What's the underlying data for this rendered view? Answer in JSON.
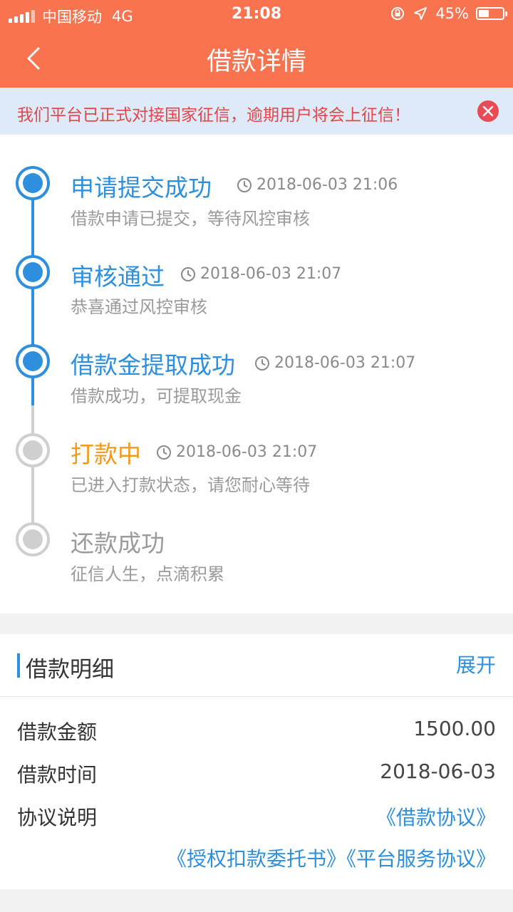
{
  "status_bar": {
    "carrier": "中国移动",
    "network": "4G",
    "time": "21:08",
    "battery": "45%",
    "battery_level": 0.45
  },
  "nav": {
    "title": "借款详情"
  },
  "notice": {
    "text": "我们平台已正式对接国家征信，逾期用户将会上征信！"
  },
  "timeline": {
    "steps": [
      {
        "title": "申请提交成功",
        "time": "2018-06-03 21:06",
        "desc": "借款申请已提交，等待风控审核",
        "state": "done"
      },
      {
        "title": "审核通过",
        "time": "2018-06-03 21:07",
        "desc": "恭喜通过风控审核",
        "state": "done"
      },
      {
        "title": "借款金提取成功",
        "time": "2018-06-03 21:07",
        "desc": "借款成功，可提取现金",
        "state": "done"
      },
      {
        "title": "打款中",
        "time": "2018-06-03 21:07",
        "desc": "已进入打款状态，请您耐心等待",
        "state": "current"
      },
      {
        "title": "还款成功",
        "time": "",
        "desc": "征信人生，点滴积累",
        "state": "pending"
      }
    ]
  },
  "detail": {
    "title": "借款明细",
    "expand_label": "展开",
    "rows": [
      {
        "label": "借款金额",
        "value": "1500.00"
      },
      {
        "label": "借款时间",
        "value": "2018-06-03"
      },
      {
        "label": "协议说明",
        "value": "《借款协议》"
      }
    ],
    "extra_links": [
      "《授权扣款委托书》",
      "《平台服务协议》"
    ]
  },
  "colors": {
    "header": "#f9734f",
    "accent_blue": "#2d8fdd",
    "accent_orange": "#f39a1c",
    "notice_bg": "#deeaf7",
    "notice_text": "#e2464a"
  }
}
